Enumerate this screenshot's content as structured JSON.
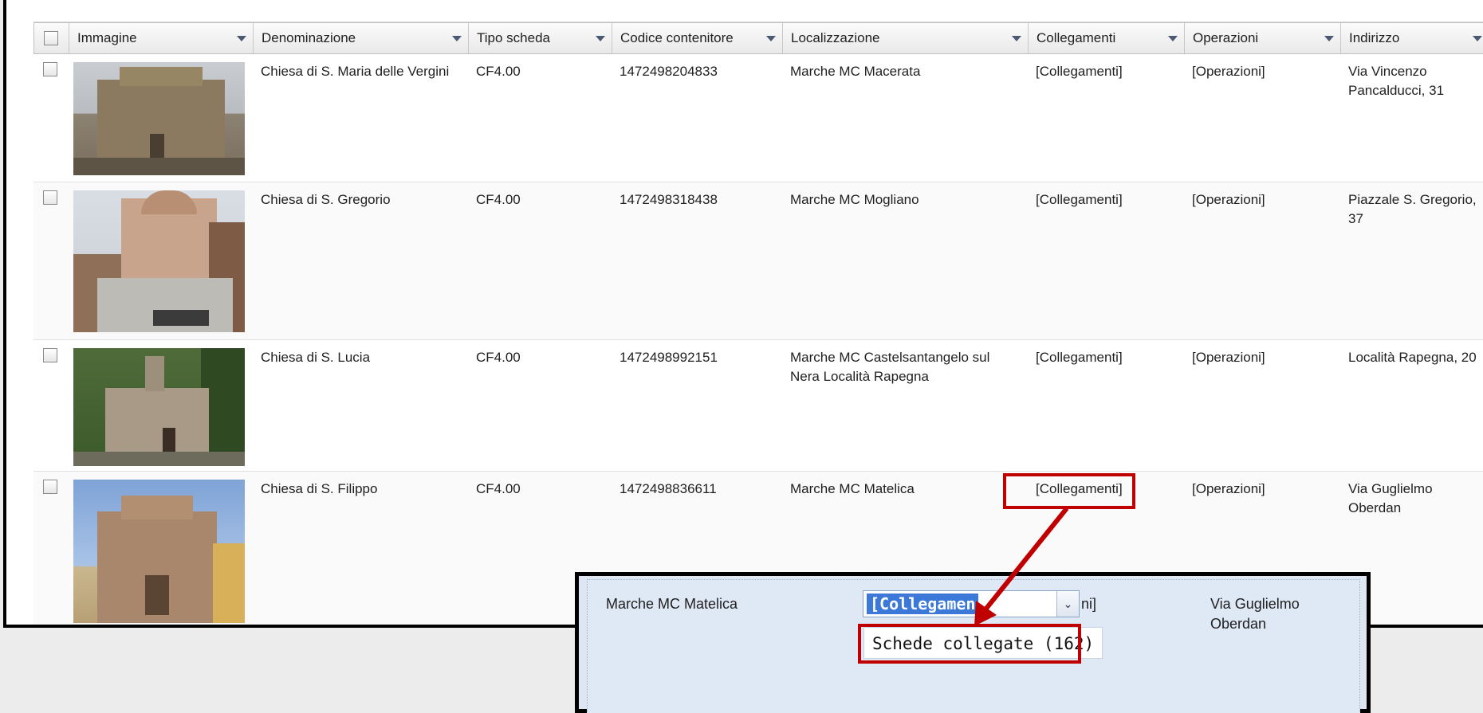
{
  "columns": [
    "Immagine",
    "Denominazione",
    "Tipo scheda",
    "Codice contenitore",
    "Localizzazione",
    "Collegamenti",
    "Operazioni",
    "Indirizzo"
  ],
  "rows": [
    {
      "denominazione": "Chiesa di S. Maria delle Vergini",
      "tipo": "CF4.00",
      "codice": "1472498204833",
      "localizzazione": "Marche MC Macerata",
      "collegamenti": "[Collegamenti]",
      "operazioni": "[Operazioni]",
      "indirizzo": "Via Vincenzo Pancalducci, 31"
    },
    {
      "denominazione": "Chiesa di S. Gregorio",
      "tipo": "CF4.00",
      "codice": "1472498318438",
      "localizzazione": "Marche MC Mogliano",
      "collegamenti": "[Collegamenti]",
      "operazioni": "[Operazioni]",
      "indirizzo": "Piazzale S. Gregorio, 37"
    },
    {
      "denominazione": "Chiesa di S. Lucia",
      "tipo": "CF4.00",
      "codice": "1472498992151",
      "localizzazione": "Marche MC Castelsantangelo sul Nera Località Rapegna",
      "collegamenti": "[Collegamenti]",
      "operazioni": "[Operazioni]",
      "indirizzo": "Località Rapegna, 20"
    },
    {
      "denominazione": "Chiesa di S. Filippo",
      "tipo": "CF4.00",
      "codice": "1472498836611",
      "localizzazione": "Marche MC Matelica",
      "collegamenti": "[Collegamenti]",
      "operazioni": "[Operazioni]",
      "indirizzo": "Via Guglielmo Oberdan"
    }
  ],
  "zoom": {
    "localizzazione": "Marche MC Matelica",
    "combo_value": "[Collegamen",
    "partial_operazioni": "ni]",
    "indirizzo": "Via Guglielmo Oberdan",
    "option": "Schede collegate (162)"
  },
  "colors": {
    "highlight": "#c00000",
    "selection": "#3b78d8"
  }
}
